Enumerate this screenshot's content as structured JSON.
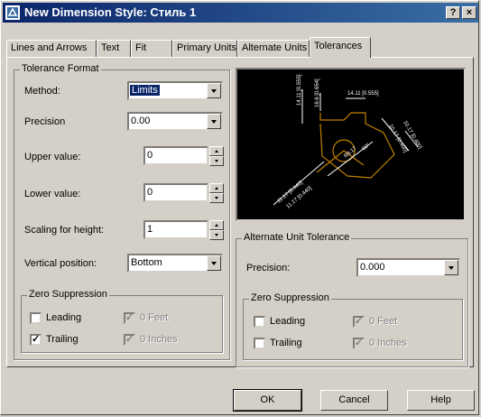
{
  "window": {
    "title": "New Dimension Style: Стиль 1",
    "help_glyph": "?",
    "close_glyph": "×"
  },
  "tabs": [
    "Lines and Arrows",
    "Text",
    "Fit",
    "Primary Units",
    "Alternate Units",
    "Tolerances"
  ],
  "active_tab": "Tolerances",
  "tolerance_format": {
    "group_title": "Tolerance Format",
    "method": {
      "label": "Method:",
      "value": "Limits"
    },
    "precision": {
      "label": "Precision",
      "value": "0.00"
    },
    "upper_value": {
      "label": "Upper value:",
      "value": "0"
    },
    "lower_value": {
      "label": "Lower value:",
      "value": "0"
    },
    "scaling_for_height": {
      "label": "Scaling for height:",
      "value": "1"
    },
    "vertical_position": {
      "label": "Vertical position:",
      "value": "Bottom"
    },
    "zero_suppression": {
      "title": "Zero Suppression",
      "leading": {
        "label": "Leading",
        "checked": false
      },
      "trailing": {
        "label": "Trailing",
        "checked": true
      },
      "feet": {
        "label": "0 Feet",
        "checked": true,
        "disabled": true
      },
      "inches": {
        "label": "0 Inches",
        "checked": true,
        "disabled": true
      }
    }
  },
  "alternate_unit_tolerance": {
    "group_title": "Alternate Unit Tolerance",
    "precision": {
      "label": "Precision:",
      "value": "0.000"
    },
    "zero_suppression": {
      "title": "Zero Suppression",
      "leading": {
        "label": "Leading",
        "checked": false
      },
      "trailing": {
        "label": "Trailing",
        "checked": false
      },
      "feet": {
        "label": "0 Feet",
        "checked": true,
        "disabled": true
      },
      "inches": {
        "label": "0 Inches",
        "checked": true,
        "disabled": true
      }
    }
  },
  "preview": {
    "labels": [
      "14.11 [0.555]",
      "14.11 [0.555]",
      "16.6 [0.654]",
      "16.6 [0.654]",
      "10.17 [0.400]",
      "10.17 [0.400]",
      "R8.17",
      "R8.17",
      "11.17 [0.440]",
      "11.17 [0.440]",
      "60°",
      "60°"
    ],
    "colors": {
      "background": "#000000",
      "dimension": "#ffffff",
      "geometry": "#c08000"
    }
  },
  "buttons": {
    "ok": "OK",
    "cancel": "Cancel",
    "help": "Help"
  }
}
